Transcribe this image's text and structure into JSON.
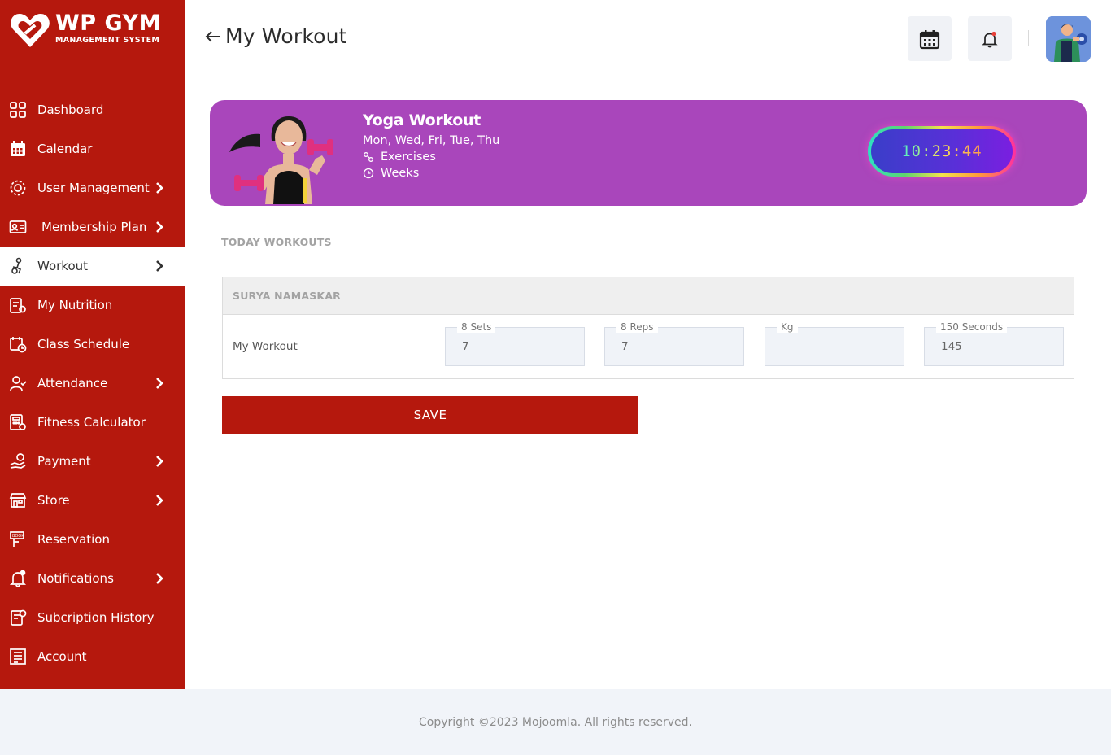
{
  "brand": {
    "title": "WP GYM",
    "subtitle": "MANAGEMENT SYSTEM",
    "color": "#b5180d"
  },
  "sidebar": {
    "items": [
      {
        "label": "Dashboard",
        "icon": "grid-icon",
        "chevron": false,
        "active": false
      },
      {
        "label": "Calendar",
        "icon": "calendar-icon",
        "chevron": false,
        "active": false
      },
      {
        "label": "User Management",
        "icon": "users-gear-icon",
        "chevron": true,
        "active": false
      },
      {
        "label": "Membership Plan",
        "icon": "id-card-icon",
        "chevron": true,
        "active": false
      },
      {
        "label": "Workout",
        "icon": "workout-icon",
        "chevron": true,
        "active": true
      },
      {
        "label": "My Nutrition",
        "icon": "nutrition-icon",
        "chevron": false,
        "active": false
      },
      {
        "label": "Class Schedule",
        "icon": "class-schedule-icon",
        "chevron": false,
        "active": false
      },
      {
        "label": "Attendance",
        "icon": "attendance-icon",
        "chevron": true,
        "active": false
      },
      {
        "label": "Fitness Calculator",
        "icon": "calculator-icon",
        "chevron": false,
        "active": false
      },
      {
        "label": "Payment",
        "icon": "payment-icon",
        "chevron": true,
        "active": false
      },
      {
        "label": "Store",
        "icon": "store-icon",
        "chevron": true,
        "active": false
      },
      {
        "label": "Reservation",
        "icon": "reservation-icon",
        "chevron": false,
        "active": false
      },
      {
        "label": "Notifications",
        "icon": "bell-icon",
        "chevron": true,
        "active": false
      },
      {
        "label": "Subcription History",
        "icon": "history-icon",
        "chevron": false,
        "active": false
      },
      {
        "label": "Account",
        "icon": "account-icon",
        "chevron": false,
        "active": false
      }
    ]
  },
  "header": {
    "title": "My Workout",
    "calendar_icon": "calendar-icon",
    "notification_icon": "bell-icon",
    "avatar": "user-avatar"
  },
  "banner": {
    "title": "Yoga Workout",
    "days": "Mon, Wed, Fri, Tue, Thu",
    "exercises_label": "Exercises",
    "weeks_label": "Weeks",
    "timer": "10:23:44",
    "color": "#a946bb"
  },
  "today": {
    "section_label": "TODAY WORKOUTS",
    "exercise_name": "SURYA NAMASKAR",
    "row_label": "My Workout",
    "fields": [
      {
        "legend": "8 Sets",
        "value": "7"
      },
      {
        "legend": "8 Reps",
        "value": "7"
      },
      {
        "legend": "Kg",
        "value": ""
      },
      {
        "legend": "150 Seconds",
        "value": "145"
      }
    ],
    "save_label": "SAVE"
  },
  "footer": {
    "copyright": "Copyright ©2023 Mojoomla. All rights reserved."
  }
}
